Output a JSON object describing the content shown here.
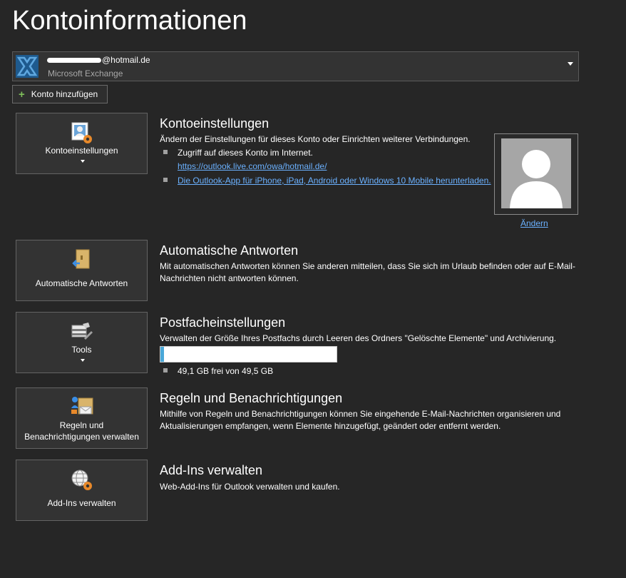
{
  "page": {
    "title": "Kontoinformationen"
  },
  "account": {
    "email_suffix": "@hotmail.de",
    "type": "Microsoft Exchange",
    "add_account_label": "Konto hinzufügen"
  },
  "colors": {
    "background": "#262626",
    "tile": "#333333",
    "link": "#6bb1ff",
    "accent_orange": "#e8892a",
    "storage_fill": "#4aa8d8"
  },
  "sections": {
    "account_settings": {
      "tile_label": "Kontoeinstellungen",
      "tile_icon": "account-settings-icon",
      "heading": "Kontoeinstellungen",
      "description": "Ändern der Einstellungen für dieses Konto oder Einrichten weiterer Verbindungen.",
      "bullet_1": "Zugriff auf dieses Konto im Internet.",
      "web_link": "https://outlook.live.com/owa/hotmail.de/",
      "app_link": "Die Outlook-App für iPhone, iPad, Android oder Windows 10 Mobile herunterladen.",
      "change_photo_label": "Ändern"
    },
    "auto_replies": {
      "tile_label": "Automatische Antworten",
      "tile_icon": "auto-reply-icon",
      "heading": "Automatische Antworten",
      "description": "Mit automatischen Antworten können Sie anderen mitteilen, dass Sie sich im Urlaub befinden oder auf E-Mail-Nachrichten nicht antworten können."
    },
    "mailbox": {
      "tile_label": "Tools",
      "tile_icon": "tools-icon",
      "heading": "Postfacheinstellungen",
      "description": "Verwalten der Größe Ihres Postfachs durch Leeren des Ordners \"Gelöschte Elemente\" und Archivierung.",
      "storage_text": "49,1 GB frei von 49,5 GB",
      "storage_used_fraction": 0.008
    },
    "rules": {
      "tile_label_line1": "Regeln und",
      "tile_label_line2": "Benachrichtigungen verwalten",
      "tile_icon": "rules-alerts-icon",
      "heading": "Regeln und Benachrichtigungen",
      "description": "Mithilfe von Regeln und Benachrichtigungen können Sie eingehende E-Mail-Nachrichten organisieren und Aktualisierungen empfangen, wenn Elemente hinzugefügt, geändert oder entfernt werden."
    },
    "addins": {
      "tile_label": "Add-Ins verwalten",
      "tile_icon": "addins-globe-icon",
      "heading": "Add-Ins verwalten",
      "description": "Web-Add-Ins für Outlook verwalten und kaufen."
    }
  }
}
